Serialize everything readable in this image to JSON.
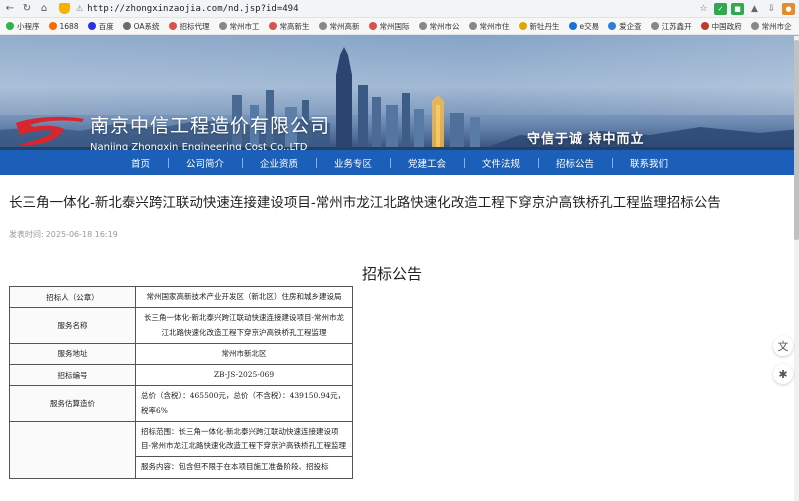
{
  "browser": {
    "url": "http://zhongxinzaojia.com/nd.jsp?id=494",
    "nav_icons": [
      "back-icon",
      "refresh-icon",
      "home-icon"
    ],
    "bookmarks": [
      {
        "label": "小程序",
        "color": "#2db54a"
      },
      {
        "label": "1688",
        "color": "#ff6a00"
      },
      {
        "label": "百度",
        "color": "#2932e1"
      },
      {
        "label": "OA系统",
        "color": "#6c6c6c"
      },
      {
        "label": "招标代理",
        "color": "#d9534f"
      },
      {
        "label": "常州市工",
        "color": "#888888"
      },
      {
        "label": "常高新生",
        "color": "#d9534f"
      },
      {
        "label": "常州高新",
        "color": "#888888"
      },
      {
        "label": "常州国际",
        "color": "#d9534f"
      },
      {
        "label": "常州市公",
        "color": "#888888"
      },
      {
        "label": "常州市住",
        "color": "#888888"
      },
      {
        "label": "新牡丹生",
        "color": "#e0a800"
      },
      {
        "label": "e交易",
        "color": "#1b6fd8"
      },
      {
        "label": "爱企查",
        "color": "#2e7ed6"
      },
      {
        "label": "江苏鑫开",
        "color": "#888888"
      },
      {
        "label": "中国政府",
        "color": "#c0392b"
      },
      {
        "label": "常州市企",
        "color": "#888888"
      }
    ]
  },
  "site": {
    "company_cn": "南京中信工程造价有限公司",
    "company_en": "Nanjing Zhongxin Engineering Cost Co.,LTD",
    "slogan": "守信于诚  持中而立",
    "nav": [
      "首页",
      "公司简介",
      "企业资质",
      "业务专区",
      "党建工会",
      "文件法规",
      "招标公告",
      "联系我们"
    ]
  },
  "article": {
    "title": "长三角一体化-新北泰兴跨江联动快速连接建设项目-常州市龙江北路快速化改造工程下穿京沪高铁桥孔工程监理招标公告",
    "pub_label": "发表时间:",
    "pub_time": "2025-06-18 16:19",
    "heading": "招标公告",
    "table": [
      {
        "label": "招标人（公章）",
        "value": "常州国家高新技术产业开发区（新北区）住房和城乡建设局",
        "center": true
      },
      {
        "label": "服务名称",
        "value": "长三角一体化-新北泰兴跨江联动快速连接建设项目-常州市龙江北路快速化改造工程下穿京沪高铁桥孔工程监理",
        "center": true
      },
      {
        "label": "服务地址",
        "value": "常州市新北区",
        "center": true
      },
      {
        "label": "招标编号",
        "value": "ZB-JS-2025-069",
        "center": true
      },
      {
        "label": "服务估算造价",
        "value": "总价（含税）：465500元，总价（不含税）：439150.94元，税率6%",
        "center": false
      },
      {
        "label": "",
        "value": "招标范围：长三角一体化-新北泰兴跨江联动快速连接建设项目-常州市龙江北路快速化改造工程下穿京沪高铁桥孔工程监理",
        "center": false
      },
      {
        "label": "",
        "value": "服务内容：包含但不限于在本项目施工准备阶段、招投标",
        "center": false
      }
    ]
  }
}
